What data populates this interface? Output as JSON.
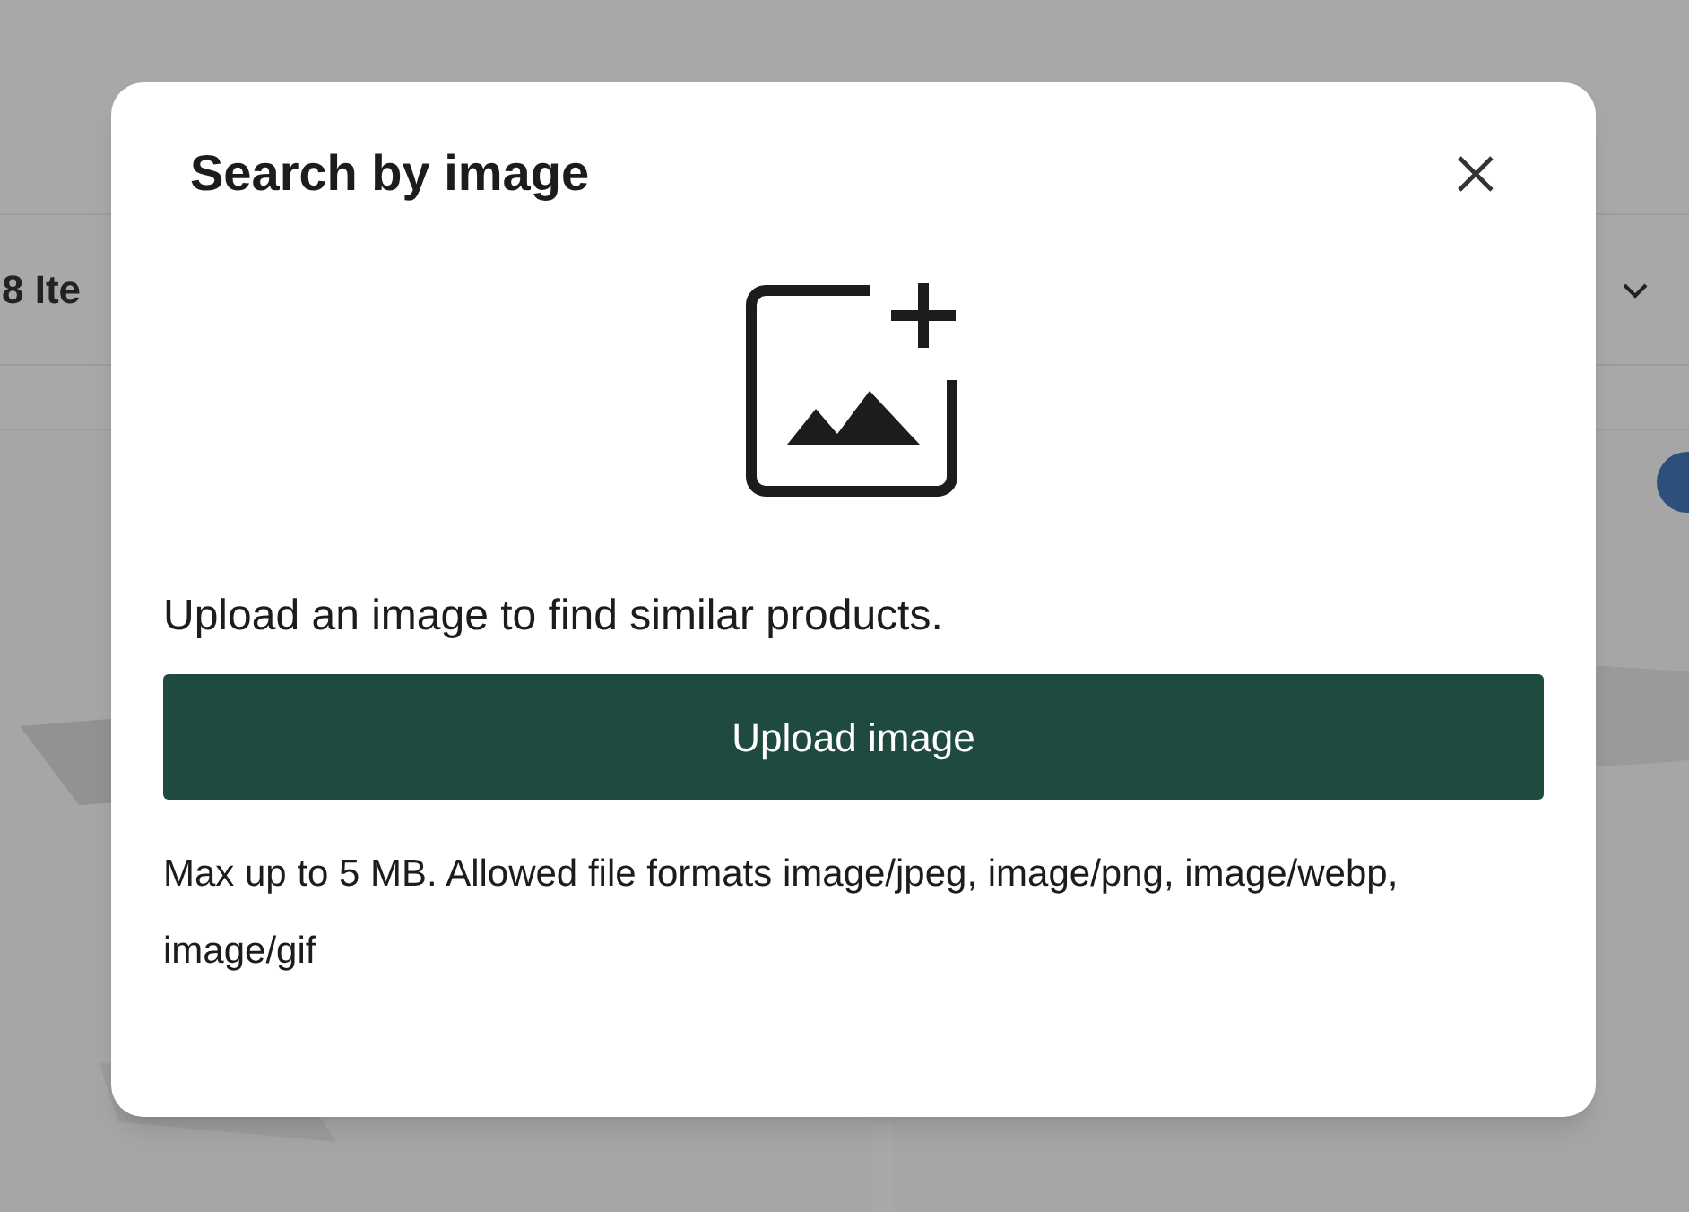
{
  "page": {
    "item_count": "8 Ite"
  },
  "dialog": {
    "title": "Search by image",
    "description": "Upload an image to find similar products.",
    "button": "Upload image",
    "note": "Max up to 5 MB. Allowed file formats image/jpeg, image/png, image/webp, image/gif"
  }
}
